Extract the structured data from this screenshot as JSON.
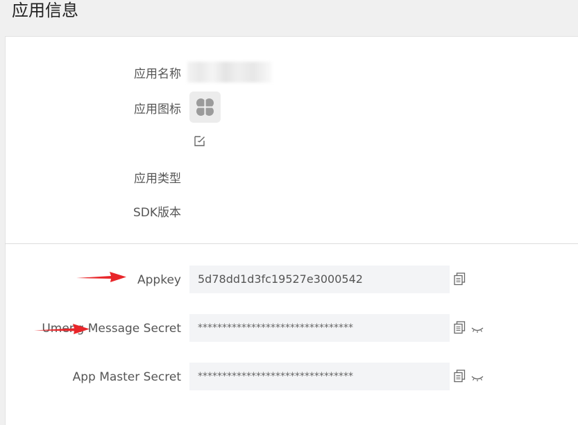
{
  "header": {
    "title": "应用信息"
  },
  "basic_info": {
    "app_name_label": "应用名称",
    "app_icon_label": "应用图标",
    "app_type_label": "应用类型",
    "sdk_version_label": "SDK版本"
  },
  "keys": {
    "appkey": {
      "label": "Appkey",
      "value": "5d78dd1d3fc19527e3000542"
    },
    "umeng_message_secret": {
      "label": "Umeng Message Secret",
      "value": "********************************"
    },
    "app_master_secret": {
      "label": "App Master Secret",
      "value": "********************************"
    }
  },
  "icons": {
    "app_icon": "clover-icon",
    "edit": "edit-icon",
    "copy": "copy-icon",
    "reveal": "eye-closed-icon",
    "annotation": "red-arrow-icon"
  },
  "colors": {
    "annotation_arrow": "#e8262a",
    "field_background": "#f3f4f6",
    "icon_grey": "#9a9a9a"
  }
}
